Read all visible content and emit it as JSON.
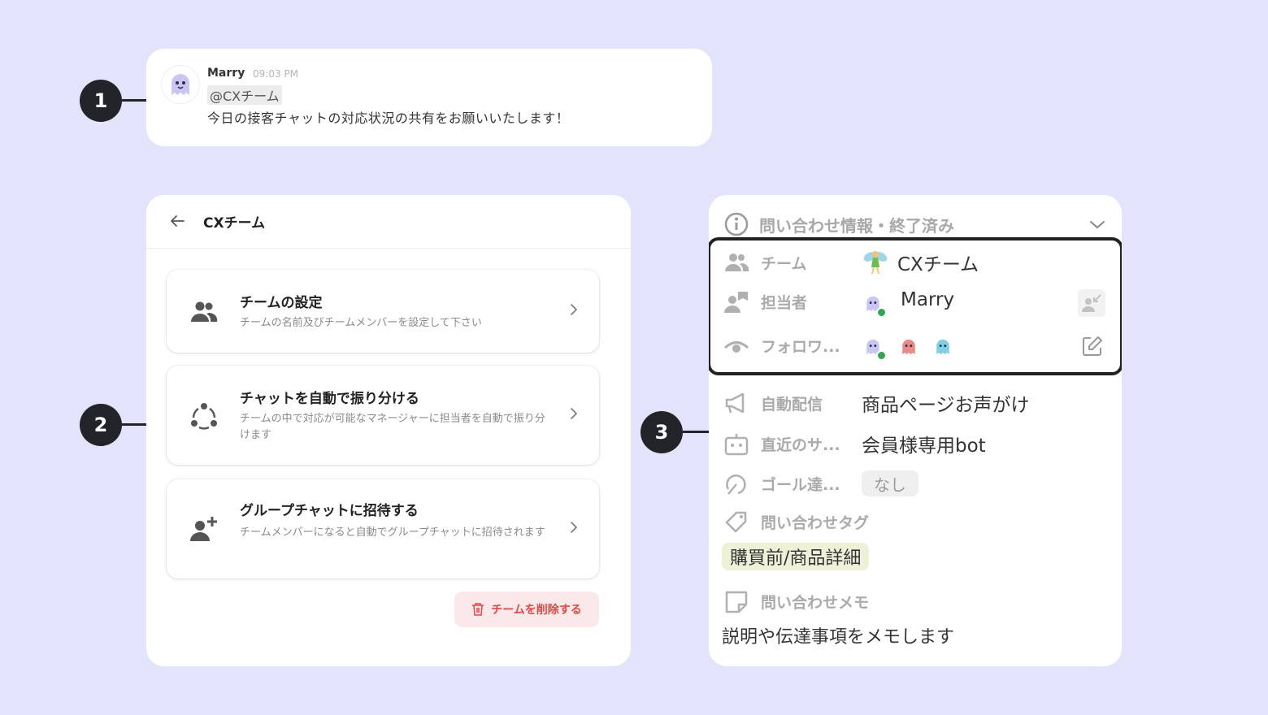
{
  "callouts": [
    "1",
    "2",
    "3"
  ],
  "message": {
    "author": "Marry",
    "time": "09:03 PM",
    "mention": "@CXチーム",
    "text": "今日の接客チャットの対応状況の共有をお願いいたします！"
  },
  "team_panel": {
    "title": "CXチーム",
    "options": [
      {
        "title": "チームの設定",
        "desc": "チームの名前及びチームメンバーを設定して下さい",
        "icon": "team-icon"
      },
      {
        "title": "チャットを自動で振り分ける",
        "desc": "チームの中で対応が可能なマネージャーに担当者を自動で振り分けます",
        "icon": "auto-assign-icon"
      },
      {
        "title": "グループチャットに招待する",
        "desc": "チームメンバーになると自動でグループチャットに招待されます",
        "icon": "add-person-icon"
      }
    ],
    "delete_label": "チームを削除する"
  },
  "info_panel": {
    "header": "問い合わせ情報・終了済み",
    "team_label": "チーム",
    "team_value": "CXチーム",
    "assignee_label": "担当者",
    "assignee_value": "Marry",
    "followers_label": "フォロワ...",
    "auto_label": "自動配信",
    "auto_value": "商品ページお声がけ",
    "recent_label": "直近のサ...",
    "recent_value": "会員様専用bot",
    "goal_label": "ゴール達...",
    "goal_value": "なし",
    "tag_label": "問い合わせタグ",
    "tag_value": "購買前/商品詳細",
    "memo_label": "問い合わせメモ",
    "memo_value": "説明や伝達事項をメモします"
  },
  "colors": {
    "background": "#e3e3fb",
    "callout": "#23232a",
    "delete_text": "#e04848",
    "delete_bg": "#fbe8e8",
    "online": "#2fa84f",
    "tag_bg": "#eef0d8"
  }
}
